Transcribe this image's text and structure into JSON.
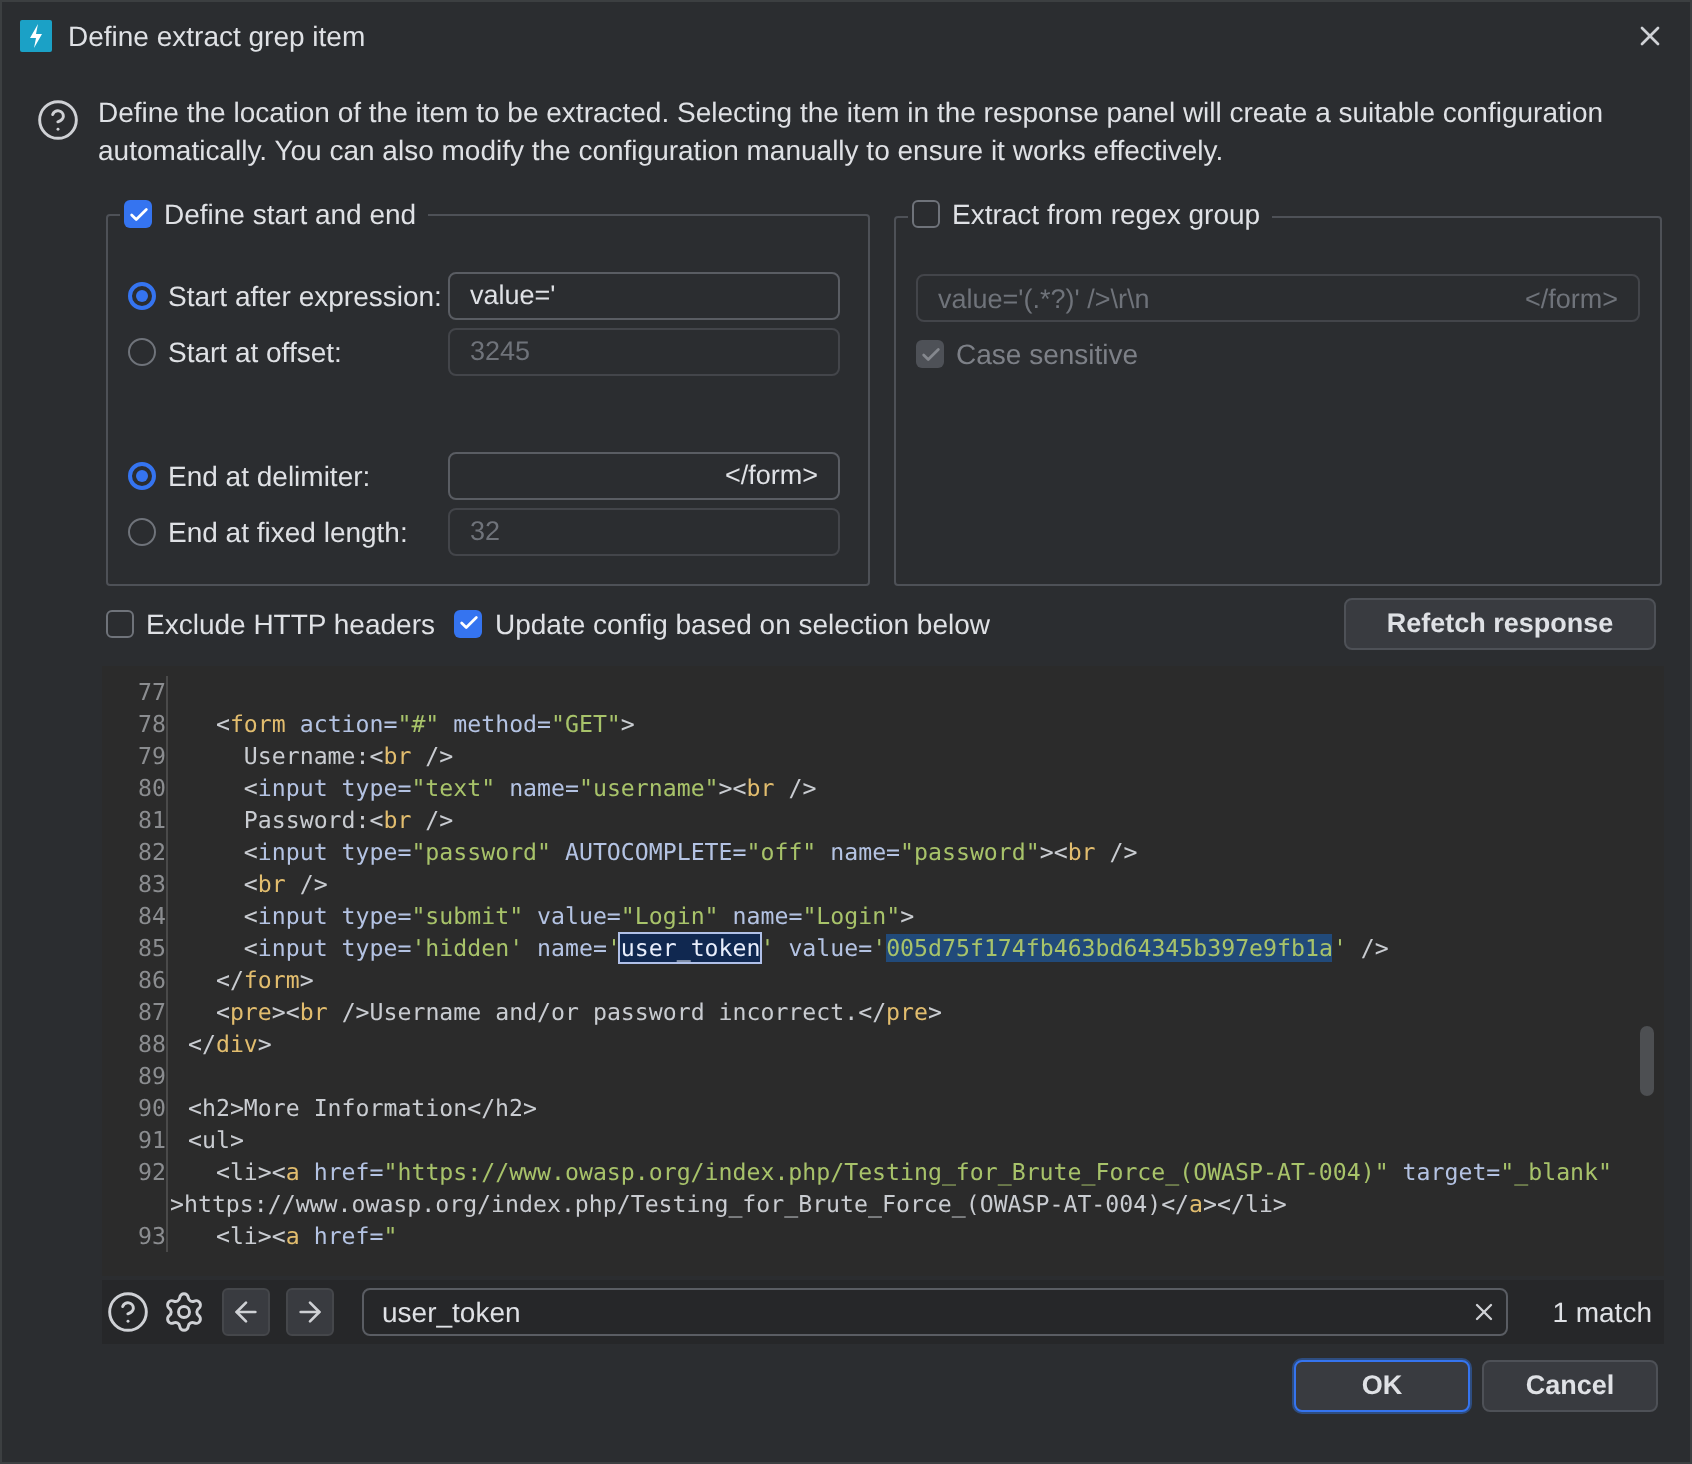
{
  "window": {
    "title": "Define extract grep item"
  },
  "description": "Define the location of the item to be extracted. Selecting the item in the response panel will create a suitable configuration automatically. You can also modify the configuration manually to ensure it works effectively.",
  "start_end_group": {
    "label": "Define start and end",
    "checked": true,
    "start_options": [
      {
        "label": "Start after expression:",
        "selected": true,
        "value": "value='"
      },
      {
        "label": "Start at offset:",
        "selected": false,
        "value": "3245"
      }
    ],
    "end_options": [
      {
        "label": "End at delimiter:",
        "selected": true,
        "value": "</form>"
      },
      {
        "label": "End at fixed length:",
        "selected": false,
        "value": "32"
      }
    ]
  },
  "regex_group": {
    "label": "Extract from regex group",
    "checked": false,
    "pattern": "value='(.*?)' />\\r\\n",
    "pattern_end": "</form>",
    "case_sensitive": {
      "label": "Case sensitive",
      "checked": true
    }
  },
  "options": [
    {
      "label": "Exclude HTTP headers",
      "checked": false
    },
    {
      "label": "Update config based on selection below",
      "checked": true
    }
  ],
  "refetch_button": "Refetch response",
  "code_lines": [
    {
      "number": "77"
    },
    {
      "number": "78",
      "segments": [
        {
          "text": "  <",
          "kind": "p"
        },
        {
          "text": "form",
          "kind": "tag"
        },
        {
          "text": " action=",
          "kind": "attr"
        },
        {
          "text": "\"#\"",
          "kind": "str"
        },
        {
          "text": " method=",
          "kind": "attr"
        },
        {
          "text": "\"GET\"",
          "kind": "str"
        },
        {
          "text": ">",
          "kind": "p"
        }
      ]
    },
    {
      "number": "79",
      "segments": [
        {
          "text": "    Username:<",
          "kind": "p"
        },
        {
          "text": "br",
          "kind": "tag"
        },
        {
          "text": " />",
          "kind": "p"
        }
      ]
    },
    {
      "number": "80",
      "segments": [
        {
          "text": "    <",
          "kind": "p"
        },
        {
          "text": "input",
          "kind": "attr"
        },
        {
          "text": " type=",
          "kind": "attr"
        },
        {
          "text": "\"text\"",
          "kind": "str"
        },
        {
          "text": " name=",
          "kind": "attr"
        },
        {
          "text": "\"username\"",
          "kind": "str"
        },
        {
          "text": "><",
          "kind": "p"
        },
        {
          "text": "br",
          "kind": "tag"
        },
        {
          "text": " />",
          "kind": "p"
        }
      ]
    },
    {
      "number": "81",
      "segments": [
        {
          "text": "    Password:<",
          "kind": "p"
        },
        {
          "text": "br",
          "kind": "tag"
        },
        {
          "text": " />",
          "kind": "p"
        }
      ]
    },
    {
      "number": "82",
      "segments": [
        {
          "text": "    <",
          "kind": "p"
        },
        {
          "text": "input",
          "kind": "attr"
        },
        {
          "text": " type=",
          "kind": "attr"
        },
        {
          "text": "\"password\"",
          "kind": "str"
        },
        {
          "text": " AUTOCOMPLETE=",
          "kind": "attr"
        },
        {
          "text": "\"off\"",
          "kind": "str"
        },
        {
          "text": " name=",
          "kind": "attr"
        },
        {
          "text": "\"password\"",
          "kind": "str"
        },
        {
          "text": "><",
          "kind": "p"
        },
        {
          "text": "br",
          "kind": "tag"
        },
        {
          "text": " />",
          "kind": "p"
        }
      ]
    },
    {
      "number": "83",
      "segments": [
        {
          "text": "    <",
          "kind": "p"
        },
        {
          "text": "br",
          "kind": "tag"
        },
        {
          "text": " />",
          "kind": "p"
        }
      ]
    },
    {
      "number": "84",
      "segments": [
        {
          "text": "    <",
          "kind": "p"
        },
        {
          "text": "input",
          "kind": "attr"
        },
        {
          "text": " type=",
          "kind": "attr"
        },
        {
          "text": "\"submit\"",
          "kind": "str"
        },
        {
          "text": " value=",
          "kind": "attr"
        },
        {
          "text": "\"Login\"",
          "kind": "str"
        },
        {
          "text": " name=",
          "kind": "attr"
        },
        {
          "text": "\"Login\"",
          "kind": "str"
        },
        {
          "text": ">",
          "kind": "p"
        }
      ]
    },
    {
      "number": "85",
      "segments": [
        {
          "text": "    <",
          "kind": "p"
        },
        {
          "text": "input",
          "kind": "attr"
        },
        {
          "text": " type=",
          "kind": "attr"
        },
        {
          "text": "'hidden'",
          "kind": "str"
        },
        {
          "text": " name=",
          "kind": "attr"
        },
        {
          "text": "'",
          "kind": "str"
        },
        {
          "text": "user_token",
          "kind": "match"
        },
        {
          "text": "'",
          "kind": "str"
        },
        {
          "text": " value=",
          "kind": "attr"
        },
        {
          "text": "'",
          "kind": "str"
        },
        {
          "text": "005d75f174fb463bd64345b397e9fb1a",
          "kind": "selection"
        },
        {
          "text": "'",
          "kind": "str"
        },
        {
          "text": " />",
          "kind": "p"
        }
      ]
    },
    {
      "number": "86",
      "segments": [
        {
          "text": "  </",
          "kind": "p"
        },
        {
          "text": "form",
          "kind": "tag"
        },
        {
          "text": ">",
          "kind": "p"
        }
      ]
    },
    {
      "number": "87",
      "segments": [
        {
          "text": "  <",
          "kind": "p"
        },
        {
          "text": "pre",
          "kind": "tag"
        },
        {
          "text": "><",
          "kind": "p"
        },
        {
          "text": "br",
          "kind": "tag"
        },
        {
          "text": " />Username and/or password incorrect.</",
          "kind": "p"
        },
        {
          "text": "pre",
          "kind": "tag"
        },
        {
          "text": ">",
          "kind": "p"
        }
      ]
    },
    {
      "number": "88",
      "segments": [
        {
          "text": "</",
          "kind": "p"
        },
        {
          "text": "div",
          "kind": "tag"
        },
        {
          "text": ">",
          "kind": "p"
        }
      ]
    },
    {
      "number": "89"
    },
    {
      "number": "90",
      "segments": [
        {
          "text": "<h2>More Information</h2>",
          "kind": "p"
        }
      ]
    },
    {
      "number": "91",
      "segments": [
        {
          "text": "<ul>",
          "kind": "p"
        }
      ]
    },
    {
      "number": "92",
      "segments": [
        {
          "text": "  <li><",
          "kind": "p"
        },
        {
          "text": "a",
          "kind": "tag"
        },
        {
          "text": " href=",
          "kind": "attr"
        },
        {
          "text": "\"https://www.owasp.org/index.php/Testing_for_Brute_Force_(OWASP-AT-004)\"",
          "kind": "str"
        },
        {
          "text": " target=",
          "kind": "attr"
        },
        {
          "text": "\"_blank\"",
          "kind": "str"
        }
      ],
      "continuation": [
        {
          "text": ">https://www.owasp.org/index.php/Testing_for_Brute_Force_(OWASP-AT-004)</",
          "kind": "p"
        },
        {
          "text": "a",
          "kind": "tag"
        },
        {
          "text": "></li>",
          "kind": "p"
        }
      ]
    },
    {
      "number": "93",
      "segments": [
        {
          "text": "  <li><",
          "kind": "p"
        },
        {
          "text": "a",
          "kind": "tag"
        },
        {
          "text": " href=",
          "kind": "attr"
        },
        {
          "text": "\"",
          "kind": "str"
        }
      ]
    }
  ],
  "search": {
    "value": "user_token",
    "match_count": "1 match"
  },
  "buttons": [
    {
      "label": "OK",
      "default": true
    },
    {
      "label": "Cancel",
      "default": false
    }
  ]
}
